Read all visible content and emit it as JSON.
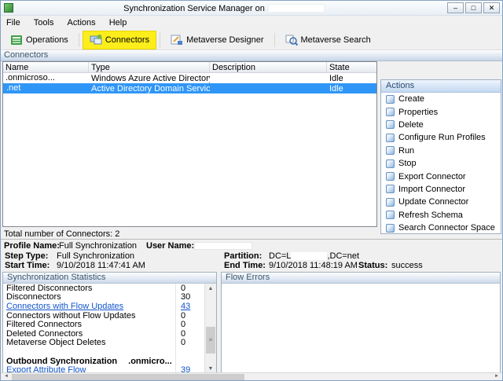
{
  "window": {
    "title": "Synchronization Service Manager on",
    "controls": {
      "minimize": "–",
      "maximize": "□",
      "close": "✕"
    }
  },
  "menu": {
    "items": [
      "File",
      "Tools",
      "Actions",
      "Help"
    ]
  },
  "toolbar": {
    "buttons": [
      {
        "label": "Operations"
      },
      {
        "label": "Connectors",
        "highlighted": true
      },
      {
        "label": "Metaverse Designer"
      },
      {
        "label": "Metaverse Search"
      }
    ]
  },
  "connectors": {
    "section_header": "Connectors",
    "columns": [
      "Name",
      "Type",
      "Description",
      "State"
    ],
    "rows": [
      {
        "name": ".onmicroso...",
        "type": "Windows Azure Active Directory (Micr...",
        "description": "",
        "state": "Idle"
      },
      {
        "name": ".net",
        "type": "Active Directory Domain Services",
        "description": "",
        "state": "Idle"
      }
    ],
    "footer": "Total number of Connectors: 2"
  },
  "actions_panel": {
    "header": "Actions",
    "items": [
      "Create",
      "Properties",
      "Delete",
      "Configure Run Profiles",
      "Run",
      "Stop",
      "Export Connector",
      "Import Connector",
      "Update Connector",
      "Refresh Schema",
      "Search Connector Space"
    ]
  },
  "run_details": {
    "profile_name_label": "Profile Name:",
    "profile_name": "Full Synchronization",
    "user_name_label": "User Name:",
    "step_type_label": "Step Type:",
    "step_type": "Full Synchronization",
    "partition_label": "Partition:",
    "partition_prefix": "DC=L",
    "partition_suffix": ",DC=net",
    "start_time_label": "Start Time:",
    "start_time": "9/10/2018 11:47:41 AM",
    "end_time_label": "End Time:",
    "end_time": "9/10/2018 11:48:19 AM",
    "status_label": "Status:",
    "status_value": "success"
  },
  "statistics": {
    "header": "Synchronization Statistics",
    "rows": [
      {
        "label": "Filtered Disconnectors",
        "value": "0"
      },
      {
        "label": "Disconnectors",
        "value": "30"
      },
      {
        "label": "Connectors with Flow Updates",
        "value": "43"
      },
      {
        "label": "Connectors without Flow Updates",
        "value": "0"
      },
      {
        "label": "Filtered Connectors",
        "value": "0"
      },
      {
        "label": "Deleted Connectors",
        "value": "0"
      },
      {
        "label": "Metaverse Object Deletes",
        "value": "0"
      }
    ],
    "outbound_label": "Outbound Synchronization",
    "outbound_suffix": ".onmicro...",
    "export_row": {
      "label": "Export Attribute Flow",
      "value": "39"
    }
  },
  "flow_errors": {
    "header": "Flow Errors"
  },
  "icons": {
    "scroll_up": "▲",
    "scroll_down": "▼",
    "scroll_left": "◄",
    "scroll_right": "►",
    "grip": "≡"
  }
}
